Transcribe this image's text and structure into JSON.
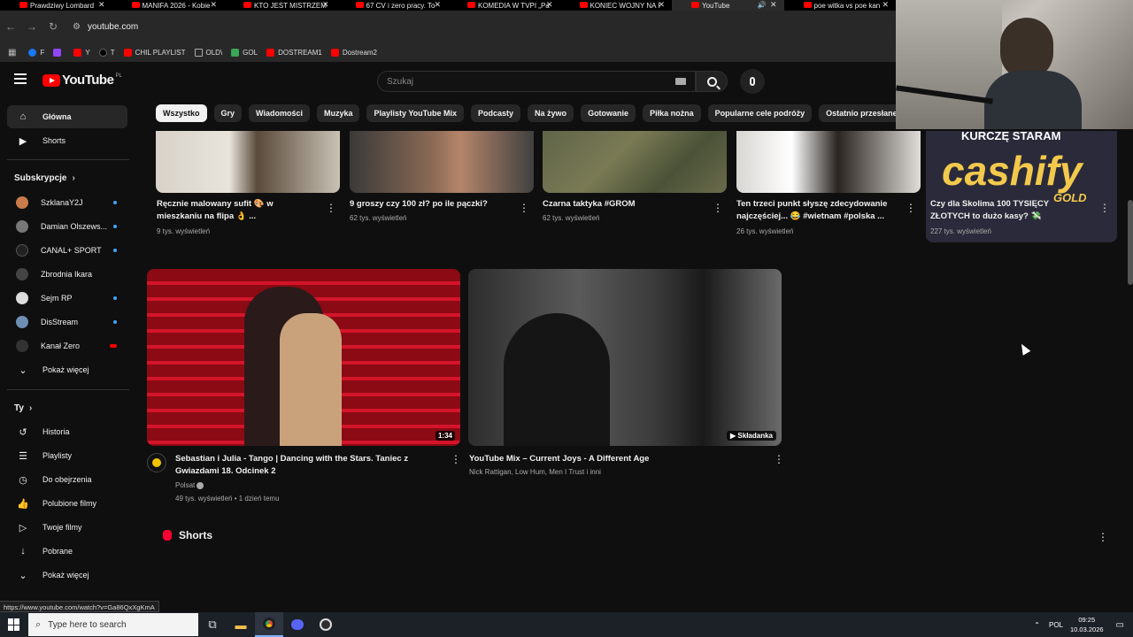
{
  "browser": {
    "tabs": [
      {
        "title": "Prawdziwy Lombard"
      },
      {
        "title": "MANIFA 2026 - Kobie"
      },
      {
        "title": "KTO JEST MISTRZEM"
      },
      {
        "title": "67 CV i zero pracy. To"
      },
      {
        "title": "KOMEDIA W TVPI „Pa"
      },
      {
        "title": "KONIEC WOJNY NA I"
      },
      {
        "title": "YouTube"
      },
      {
        "title": "poe witka vs poe kan"
      }
    ],
    "url": "youtube.com",
    "bookmarks": [
      {
        "label": "F",
        "color": "#1877f2"
      },
      {
        "label": "",
        "color": "#9146ff"
      },
      {
        "label": "Y",
        "color": "#ff0000"
      },
      {
        "label": "T",
        "color": "#000000"
      },
      {
        "label": "CHIL PLAYLIST",
        "color": "#ff0000"
      },
      {
        "label": "OLD\\",
        "color": "#888888"
      },
      {
        "label": "GOL",
        "color": "#3aa757"
      },
      {
        "label": "DOSTREAM1",
        "color": "#ff0000"
      },
      {
        "label": "Dostream2",
        "color": "#ff0000"
      }
    ],
    "status_url": "https://www.youtube.com/watch?v=Ga86QxXgKmA"
  },
  "youtube": {
    "logo": "YouTube",
    "region": "PL",
    "search_placeholder": "Szukaj",
    "chips": [
      "Wszystko",
      "Gry",
      "Wiadomości",
      "Muzyka",
      "Playlisty YouTube Mix",
      "Podcasty",
      "Na żywo",
      "Gotowanie",
      "Piłka nożna",
      "Popularne cele podróży",
      "Ostatnio przesłane"
    ],
    "sidebar": {
      "home": "Główna",
      "shorts": "Shorts",
      "subs_heading": "Subskrypcje",
      "subs": [
        {
          "name": "SzklanaY2J",
          "color": "#c97b4a"
        },
        {
          "name": "Damian Olszews...",
          "color": "#777777"
        },
        {
          "name": "CANAL+ SPORT",
          "color": "#222222"
        },
        {
          "name": "Zbrodnia Ikara",
          "color": "#444444"
        },
        {
          "name": "Sejm RP",
          "color": "#dddddd"
        },
        {
          "name": "DisStream",
          "color": "#6e8fb3"
        },
        {
          "name": "Kanał Zero",
          "color": "#333333"
        }
      ],
      "show_more": "Pokaż więcej",
      "you_heading": "Ty",
      "you_items": [
        "Historia",
        "Playlisty",
        "Do obejrzenia",
        "Polubione filmy",
        "Twoje filmy",
        "Pobrane",
        "Pokaż więcej"
      ]
    },
    "top_videos": [
      {
        "title": "Ręcznie malowany sufit 🎨 w mieszkaniu na flipa 👌 ...",
        "views": "9 tys. wyświetleń"
      },
      {
        "title": "9 groszy czy 100 zł? po ile pączki?",
        "views": "62 tys. wyświetleń"
      },
      {
        "title": "Czarna taktyka #GROM",
        "views": "62 tys. wyświetleń"
      },
      {
        "title": "Ten trzeci punkt słyszę zdecydowanie najczęściej... 😂 #wietnam #polska ...",
        "views": "26 tys. wyświetleń"
      },
      {
        "title": "Czy dla Skolima 100 TYSIĘCY ZŁOTYCH to dużo kasy? 💸",
        "views": "227 tys. wyświetleń",
        "thumb_text": "KURCZĘ STARAM",
        "thumb_brand": "cashify",
        "thumb_sub": "GOLD"
      }
    ],
    "videos": [
      {
        "title": "Sebastian i Julia - Tango | Dancing with the Stars. Taniec z Gwiazdami 18. Odcinek 2",
        "channel": "Polsat",
        "meta": "49 tys. wyświetleń • 1 dzień temu",
        "duration": "1:34"
      },
      {
        "title": "YouTube Mix – Current Joys - A Different Age",
        "channel": "Nick Rattigan, Low Hum, Men I Trust i inni",
        "badge": "Składanka"
      }
    ],
    "shorts_heading": "Shorts"
  },
  "taskbar": {
    "search_placeholder": "Type here to search",
    "lang": "POL",
    "time": "09:25",
    "date": "10.03.2026"
  }
}
